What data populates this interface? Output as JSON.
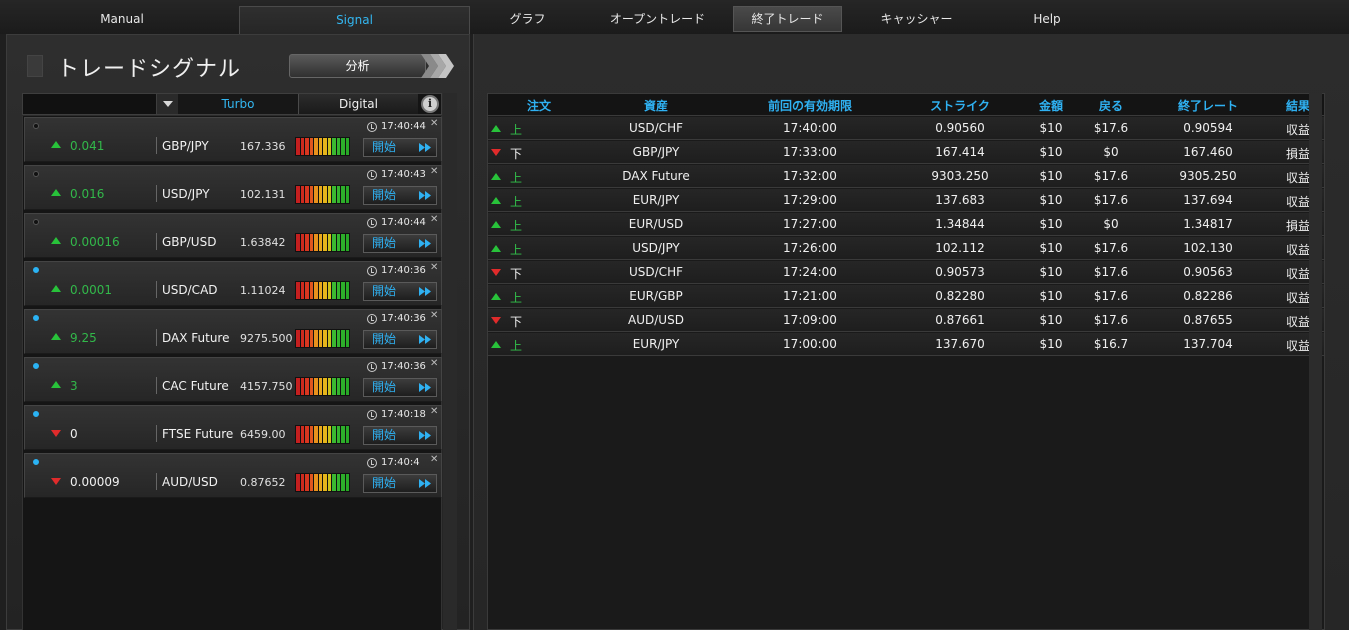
{
  "nav": {
    "tabs": [
      "Manual",
      "Signal",
      "グラフ",
      "オープントレード",
      "終了トレード",
      "キャッシャー",
      "Help"
    ],
    "active_left": "Signal",
    "active_right": "終了トレード"
  },
  "signal_panel": {
    "title": "トレードシグナル",
    "analyze_label": "分析",
    "filter_tabs": {
      "turbo": "Turbo",
      "digital": "Digital"
    },
    "start_label": "開始",
    "signals": [
      {
        "dot": "dark",
        "direction": "up",
        "change": "0.041",
        "asset": "GBP/JPY",
        "price": "167.336",
        "time": "17:40:44"
      },
      {
        "dot": "dark",
        "direction": "up",
        "change": "0.016",
        "asset": "USD/JPY",
        "price": "102.131",
        "time": "17:40:43"
      },
      {
        "dot": "dark",
        "direction": "up",
        "change": "0.00016",
        "asset": "GBP/USD",
        "price": "1.63842",
        "time": "17:40:44"
      },
      {
        "dot": "blue",
        "direction": "up",
        "change": "0.0001",
        "asset": "USD/CAD",
        "price": "1.11024",
        "time": "17:40:36"
      },
      {
        "dot": "blue",
        "direction": "up",
        "change": "9.25",
        "asset": "DAX Future",
        "price": "9275.500",
        "time": "17:40:36"
      },
      {
        "dot": "blue",
        "direction": "up",
        "change": "3",
        "asset": "CAC Future",
        "price": "4157.750",
        "time": "17:40:36"
      },
      {
        "dot": "blue",
        "direction": "down",
        "change": "0",
        "asset": "FTSE Future",
        "price": "6459.00",
        "time": "17:40:18"
      },
      {
        "dot": "blue",
        "direction": "down",
        "change": "0.00009",
        "asset": "AUD/USD",
        "price": "0.87652",
        "time": "17:40:4"
      }
    ]
  },
  "closed_trades": {
    "headers": [
      "注文",
      "資産",
      "前回の有効期限",
      "ストライク",
      "金額",
      "戻る",
      "終了レート",
      "結果"
    ],
    "rows": [
      {
        "direction": "up",
        "order": "上",
        "asset": "USD/CHF",
        "expiry": "17:40:00",
        "strike": "0.90560",
        "amount": "$10",
        "return": "$17.6",
        "close_rate": "0.90594",
        "result": "収益"
      },
      {
        "direction": "down",
        "order": "下",
        "asset": "GBP/JPY",
        "expiry": "17:33:00",
        "strike": "167.414",
        "amount": "$10",
        "return": "$0",
        "close_rate": "167.460",
        "result": "損益"
      },
      {
        "direction": "up",
        "order": "上",
        "asset": "DAX Future",
        "expiry": "17:32:00",
        "strike": "9303.250",
        "amount": "$10",
        "return": "$17.6",
        "close_rate": "9305.250",
        "result": "収益"
      },
      {
        "direction": "up",
        "order": "上",
        "asset": "EUR/JPY",
        "expiry": "17:29:00",
        "strike": "137.683",
        "amount": "$10",
        "return": "$17.6",
        "close_rate": "137.694",
        "result": "収益"
      },
      {
        "direction": "up",
        "order": "上",
        "asset": "EUR/USD",
        "expiry": "17:27:00",
        "strike": "1.34844",
        "amount": "$10",
        "return": "$0",
        "close_rate": "1.34817",
        "result": "損益"
      },
      {
        "direction": "up",
        "order": "上",
        "asset": "USD/JPY",
        "expiry": "17:26:00",
        "strike": "102.112",
        "amount": "$10",
        "return": "$17.6",
        "close_rate": "102.130",
        "result": "収益"
      },
      {
        "direction": "down",
        "order": "下",
        "asset": "USD/CHF",
        "expiry": "17:24:00",
        "strike": "0.90573",
        "amount": "$10",
        "return": "$17.6",
        "close_rate": "0.90563",
        "result": "収益"
      },
      {
        "direction": "up",
        "order": "上",
        "asset": "EUR/GBP",
        "expiry": "17:21:00",
        "strike": "0.82280",
        "amount": "$10",
        "return": "$17.6",
        "close_rate": "0.82286",
        "result": "収益"
      },
      {
        "direction": "down",
        "order": "下",
        "asset": "AUD/USD",
        "expiry": "17:09:00",
        "strike": "0.87661",
        "amount": "$10",
        "return": "$17.6",
        "close_rate": "0.87655",
        "result": "収益"
      },
      {
        "direction": "up",
        "order": "上",
        "asset": "EUR/JPY",
        "expiry": "17:00:00",
        "strike": "137.670",
        "amount": "$10",
        "return": "$16.7",
        "close_rate": "137.704",
        "result": "収益"
      }
    ]
  },
  "colors": {
    "accent_blue": "#2fb1f2",
    "up_green": "#28c23a",
    "down_red": "#e02b2b"
  }
}
